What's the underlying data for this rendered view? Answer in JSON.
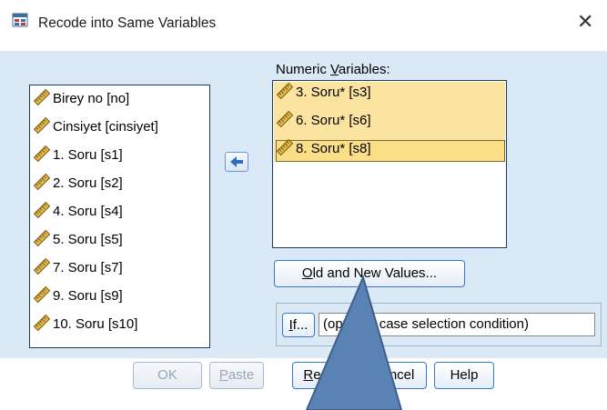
{
  "window": {
    "title": "Recode into Same Variables",
    "close_glyph": "✕"
  },
  "source_list": {
    "items": [
      {
        "label": "Birey no [no]",
        "icon": "ruler-icon"
      },
      {
        "label": "Cinsiyet [cinsiyet]",
        "icon": "ruler-icon"
      },
      {
        "label": "1. Soru [s1]",
        "icon": "ruler-icon"
      },
      {
        "label": "2. Soru [s2]",
        "icon": "ruler-icon"
      },
      {
        "label": "4. Soru [s4]",
        "icon": "ruler-icon"
      },
      {
        "label": "5. Soru [s5]",
        "icon": "ruler-icon"
      },
      {
        "label": "7. Soru [s7]",
        "icon": "ruler-icon"
      },
      {
        "label": "9. Soru [s9]",
        "icon": "ruler-icon"
      },
      {
        "label": "10. Soru [s10]",
        "icon": "ruler-icon"
      }
    ]
  },
  "numeric_variables": {
    "label_prefix": "Numeric ",
    "label_underline": "V",
    "label_rest": "ariables:",
    "items": [
      {
        "label": "3. Soru* [s3]",
        "icon": "ruler-icon"
      },
      {
        "label": "6. Soru* [s6]",
        "icon": "ruler-icon"
      },
      {
        "label": "8. Soru* [s8]",
        "icon": "ruler-icon"
      }
    ]
  },
  "move_button": {
    "icon": "arrow-left-icon"
  },
  "old_new_button": {
    "underline": "O",
    "rest": "ld and New Values..."
  },
  "if_button": {
    "underline": "I",
    "rest": "f..."
  },
  "condition_text": "(optional case selection condition)",
  "buttons": {
    "ok": "OK",
    "paste_underline": "P",
    "paste_rest": "aste",
    "reset_underline": "R",
    "reset_rest": "eset",
    "cancel": "Cancel",
    "help": "Help"
  },
  "colors": {
    "client_bg": "#dbe8f5",
    "selection": "#fbdf86",
    "pointer": "#5a82b4"
  }
}
